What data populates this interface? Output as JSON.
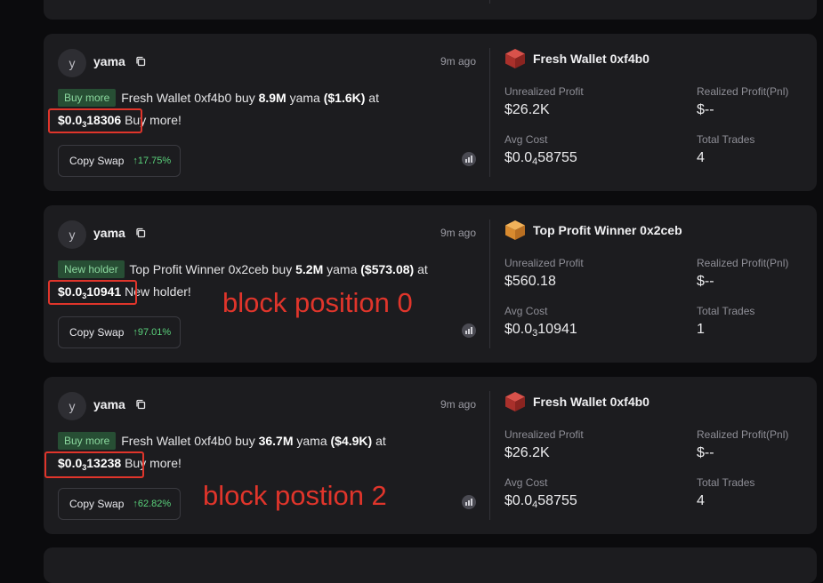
{
  "cards": [
    {
      "avatar_letter": "y",
      "name": "yama",
      "time": "9m ago",
      "tag": "Buy more",
      "msg_pre": "Fresh Wallet 0xf4b0 buy ",
      "amount": "8.9M",
      "msg_mid": " yama ",
      "usd": "($1.6K)",
      "msg_at": " at",
      "price_prefix": "$0.0",
      "price_sub": "3",
      "price_digits": "18306",
      "msg_post": " Buy more!",
      "copy_label": "Copy Swap",
      "copy_pct": "↑17.75%",
      "wallet_name": "Fresh Wallet 0xf4b0",
      "unrealized_label": "Unrealized Profit",
      "unrealized_value": "$26.2K",
      "realized_label": "Realized Profit(Pnl)",
      "realized_value": "$--",
      "avg_label": "Avg Cost",
      "avg_prefix": "$0.0",
      "avg_sub": "4",
      "avg_digits": "58755",
      "trades_label": "Total Trades",
      "trades_value": "4"
    },
    {
      "avatar_letter": "y",
      "name": "yama",
      "time": "9m ago",
      "tag": "New holder",
      "msg_pre": "Top Profit Winner 0x2ceb buy ",
      "amount": "5.2M",
      "msg_mid": " yama ",
      "usd": "($573.08)",
      "msg_at": " at",
      "price_prefix": "$0.0",
      "price_sub": "3",
      "price_digits": "10941",
      "msg_post": " New holder!",
      "copy_label": "Copy Swap",
      "copy_pct": "↑97.01%",
      "wallet_name": "Top Profit Winner 0x2ceb",
      "unrealized_label": "Unrealized Profit",
      "unrealized_value": "$560.18",
      "realized_label": "Realized Profit(Pnl)",
      "realized_value": "$--",
      "avg_label": "Avg Cost",
      "avg_prefix": "$0.0",
      "avg_sub": "3",
      "avg_digits": "10941",
      "trades_label": "Total Trades",
      "trades_value": "1"
    },
    {
      "avatar_letter": "y",
      "name": "yama",
      "time": "9m ago",
      "tag": "Buy more",
      "msg_pre": "Fresh Wallet 0xf4b0 buy ",
      "amount": "36.7M",
      "msg_mid": " yama ",
      "usd": "($4.9K)",
      "msg_at": " at",
      "price_prefix": "$0.0",
      "price_sub": "3",
      "price_digits": "13238",
      "msg_post": " Buy more!",
      "copy_label": "Copy Swap",
      "copy_pct": "↑62.82%",
      "wallet_name": "Fresh Wallet 0xf4b0",
      "unrealized_label": "Unrealized Profit",
      "unrealized_value": "$26.2K",
      "realized_label": "Realized Profit(Pnl)",
      "realized_value": "$--",
      "avg_label": "Avg Cost",
      "avg_prefix": "$0.0",
      "avg_sub": "4",
      "avg_digits": "58755",
      "trades_label": "Total Trades",
      "trades_value": "4"
    }
  ],
  "annotations": {
    "first": "block position 0",
    "second": "block postion 2"
  },
  "colors": {
    "annotation": "#e0352b",
    "tag_bg": "#274e34",
    "tag_text": "#8bd89e",
    "positive": "#5ad17b",
    "cube_red": "#c43b36",
    "cube_orange": "#e0973a"
  },
  "icons": [
    "copy-icon",
    "cube-icon",
    "chart-icon"
  ]
}
